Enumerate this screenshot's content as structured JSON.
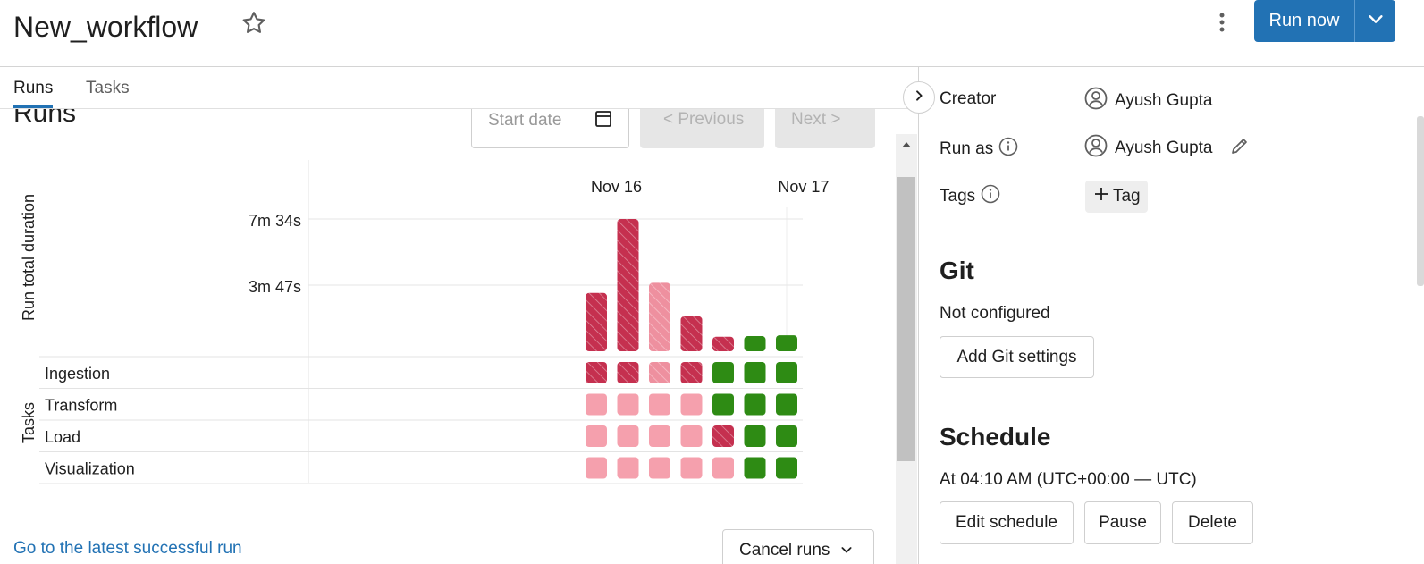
{
  "header": {
    "title": "New_workflow",
    "run_now_label": "Run now"
  },
  "tabs": [
    {
      "label": "Runs",
      "active": true
    },
    {
      "label": "Tasks",
      "active": false
    }
  ],
  "runs": {
    "heading": "Runs",
    "start_date_placeholder": "Start date",
    "previous_label": "< Previous",
    "next_label": "Next >",
    "latest_link": "Go to the latest successful run",
    "cancel_runs_label": "Cancel runs"
  },
  "chart_data": {
    "type": "bar",
    "ylabel": "Run total duration",
    "tasks_label": "Tasks",
    "y_ticks": [
      "7m 34s",
      "3m 47s"
    ],
    "y_tick_seconds": [
      454,
      227
    ],
    "date_labels": [
      {
        "label": "Nov 16",
        "at_run": 1
      },
      {
        "label": "Nov 17",
        "at_run": 6.9
      }
    ],
    "runs": [
      {
        "duration_s": 200,
        "status": "failed"
      },
      {
        "duration_s": 454,
        "status": "failed"
      },
      {
        "duration_s": 235,
        "status": "failed-light"
      },
      {
        "duration_s": 120,
        "status": "failed"
      },
      {
        "duration_s": 50,
        "status": "failed"
      },
      {
        "duration_s": 52,
        "status": "succeeded"
      },
      {
        "duration_s": 55,
        "status": "succeeded"
      }
    ],
    "task_rows": [
      {
        "name": "Ingestion",
        "statuses": [
          "failed",
          "failed",
          "failed-light",
          "failed",
          "succeeded",
          "succeeded",
          "succeeded"
        ]
      },
      {
        "name": "Transform",
        "statuses": [
          "skipped",
          "skipped",
          "skipped",
          "skipped",
          "succeeded",
          "succeeded",
          "succeeded"
        ]
      },
      {
        "name": "Load",
        "statuses": [
          "skipped",
          "skipped",
          "skipped",
          "skipped",
          "failed",
          "succeeded",
          "succeeded"
        ]
      },
      {
        "name": "Visualization",
        "statuses": [
          "skipped",
          "skipped",
          "skipped",
          "skipped",
          "skipped",
          "succeeded",
          "succeeded"
        ]
      }
    ],
    "colors": {
      "failed": "#c5304f",
      "failed-light": "#ee909f",
      "skipped": "#f5a0ad",
      "succeeded": "#2e8b14"
    }
  },
  "details": {
    "creator_label": "Creator",
    "creator_value": "Ayush Gupta",
    "run_as_label": "Run as",
    "run_as_value": "Ayush Gupta",
    "tags_label": "Tags",
    "tag_button": "Tag",
    "git_title": "Git",
    "git_status": "Not configured",
    "git_button": "Add Git settings",
    "schedule_title": "Schedule",
    "schedule_text": "At 04:10 AM (UTC+00:00 — UTC)",
    "edit_schedule": "Edit schedule",
    "pause": "Pause",
    "delete": "Delete"
  },
  "icons": [
    "star-icon",
    "kebab-menu-icon",
    "chevron-down-icon",
    "calendar-icon",
    "chevron-right-icon",
    "user-circle-icon",
    "info-icon",
    "pencil-icon",
    "plus-icon",
    "scroll-up-arrow-icon"
  ]
}
